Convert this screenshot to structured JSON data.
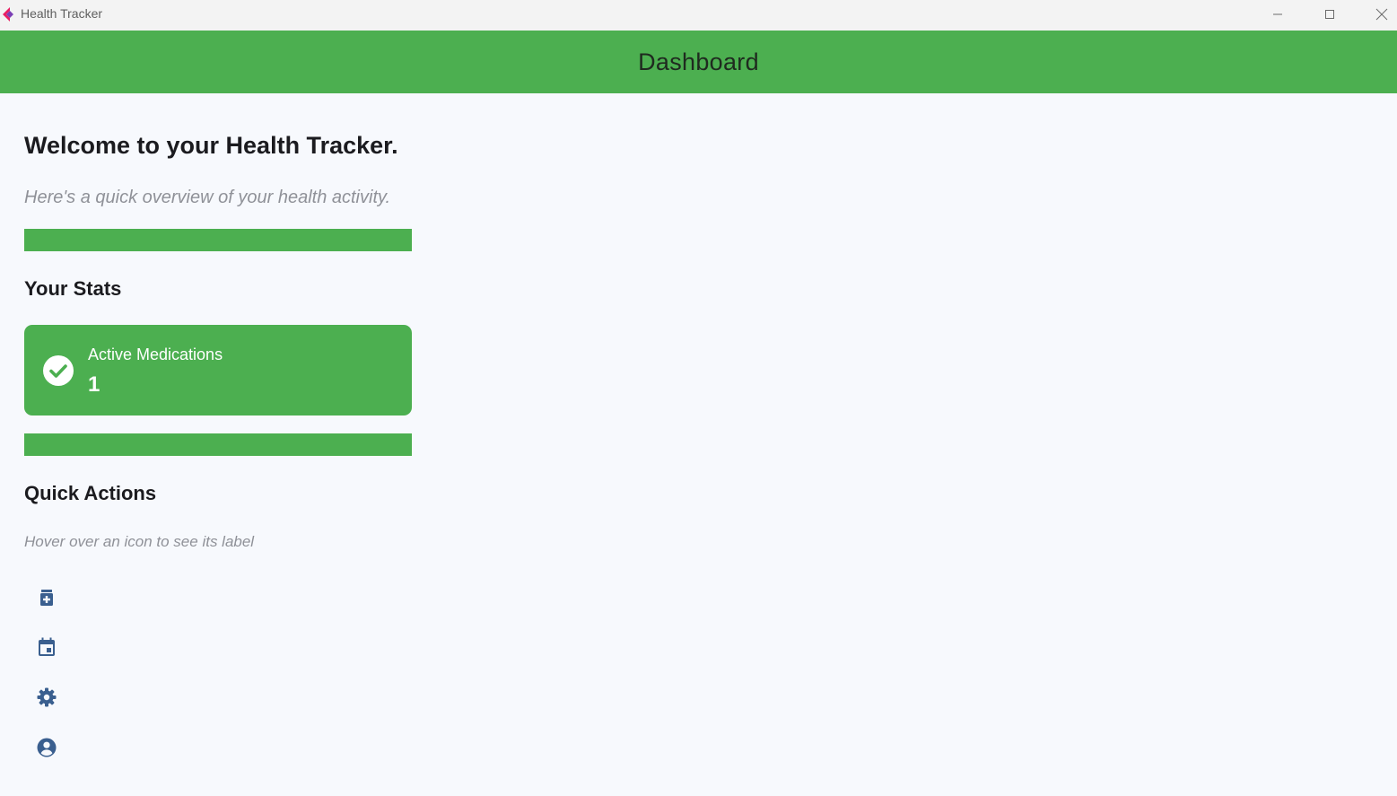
{
  "window": {
    "title": "Health Tracker"
  },
  "appbar": {
    "title": "Dashboard"
  },
  "main": {
    "welcome": "Welcome to your Health Tracker.",
    "subtitle": "Here's a quick overview of your health activity.",
    "stats_title": "Your Stats",
    "stat_card": {
      "label": "Active Medications",
      "value": "1",
      "icon": "check-circle-icon"
    },
    "actions_title": "Quick Actions",
    "actions_hint": "Hover over an icon to see its label",
    "actions": [
      {
        "icon": "medication-icon"
      },
      {
        "icon": "calendar-icon"
      },
      {
        "icon": "settings-gear-icon"
      },
      {
        "icon": "account-circle-icon"
      }
    ]
  },
  "colors": {
    "accent_green": "#4caf50",
    "icon_blue": "#3a5f8f",
    "background": "#f7f9fd"
  }
}
